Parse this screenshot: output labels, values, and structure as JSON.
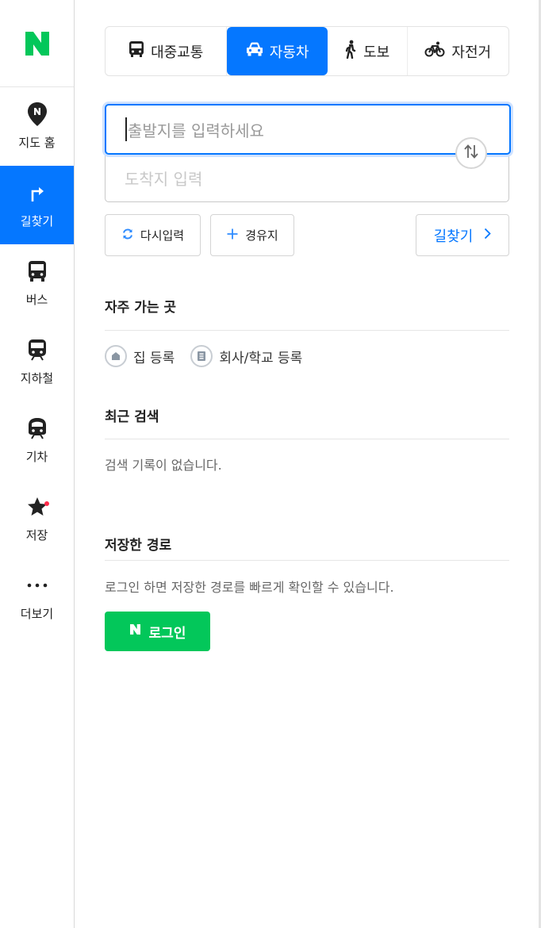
{
  "nav": {
    "logo_letter": "N",
    "items": [
      {
        "label": "지도 홈",
        "icon": "map-pin-icon"
      },
      {
        "label": "길찾기",
        "icon": "directions-icon",
        "active": true
      },
      {
        "label": "버스",
        "icon": "bus-icon"
      },
      {
        "label": "지하철",
        "icon": "subway-icon"
      },
      {
        "label": "기차",
        "icon": "train-icon"
      },
      {
        "label": "저장",
        "icon": "star-icon",
        "has_new_dot": true
      },
      {
        "label": "더보기",
        "icon": "more-icon"
      }
    ]
  },
  "tabs": [
    {
      "label": "대중교통",
      "icon": "bus-icon"
    },
    {
      "label": "자동차",
      "icon": "car-icon",
      "active": true
    },
    {
      "label": "도보",
      "icon": "walk-icon"
    },
    {
      "label": "자전거",
      "icon": "bike-icon"
    }
  ],
  "search": {
    "start_placeholder": "출발지를 입력하세요",
    "end_placeholder": "도착지 입력"
  },
  "actions": {
    "reset": "다시입력",
    "via": "경유지",
    "route": "길찾기"
  },
  "frequent": {
    "title": "자주 가는 곳",
    "home": "집 등록",
    "work": "회사/학교 등록"
  },
  "recent": {
    "title": "최근 검색",
    "empty": "검색 기록이 없습니다."
  },
  "saved": {
    "title": "저장한 경로",
    "message": "로그인 하면 저장한 경로를 빠르게 확인할 수 있습니다.",
    "login_label": "로그인",
    "login_logo": "N"
  },
  "colors": {
    "accent": "#0577ff",
    "brand_green": "#03c75a",
    "notification": "#ff2b4a"
  }
}
